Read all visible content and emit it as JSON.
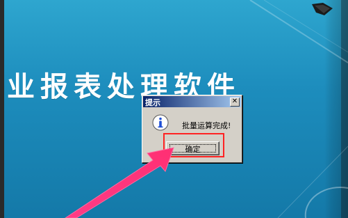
{
  "background": {
    "title": "业报表处理软件"
  },
  "dialog": {
    "title": "提示",
    "close_label": "✕",
    "message": "批量运算完成!",
    "ok_label": "确定"
  },
  "icons": {
    "info": "info-icon",
    "annotation": "arrow-icon"
  },
  "colors": {
    "highlight": "#ff2222",
    "arrow": "#ff2f73",
    "background": "#1f86b3"
  }
}
